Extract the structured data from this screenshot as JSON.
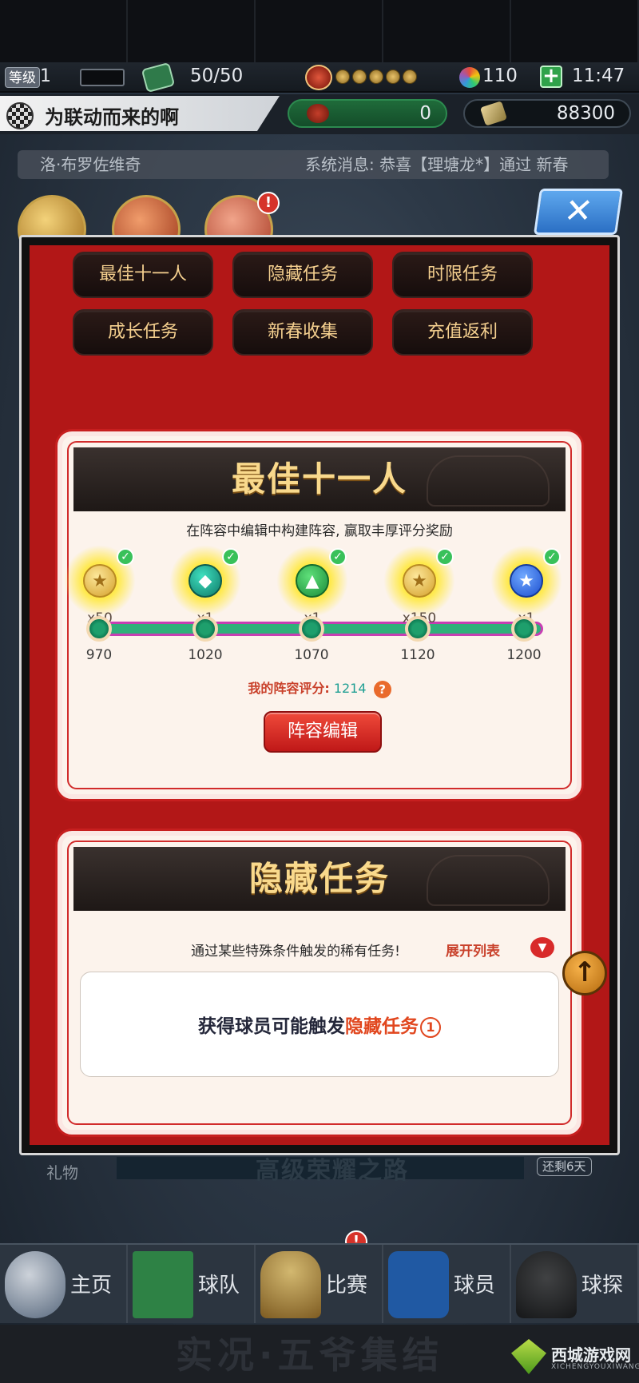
{
  "status": {
    "level_label": "等级",
    "level_value": "1",
    "stamina": "50/50",
    "gems": "110",
    "time": "11:47"
  },
  "profile": {
    "team_name": "为联动而来的啊",
    "red_currency": "0",
    "gold_currency": "88300"
  },
  "system_message": {
    "player": "洛·布罗佐维奇",
    "text": "系统消息: 恭喜【理塘龙*】通过 新春"
  },
  "tabs": [
    "最佳十一人",
    "隐藏任务",
    "时限任务",
    "成长任务",
    "新春收集",
    "充值返利"
  ],
  "best_eleven": {
    "title": "最佳十一人",
    "description": "在阵容中编辑中构建阵容, 赢取丰厚评分奖励",
    "rewards": [
      {
        "icon": "coin-icon",
        "glyph": "★",
        "qty": "x50",
        "threshold": "970",
        "claimed": true
      },
      {
        "icon": "ticket-icon",
        "glyph": "◆",
        "qty": "x1",
        "threshold": "1020",
        "claimed": true
      },
      {
        "icon": "boot-icon",
        "glyph": "▲",
        "qty": "x1",
        "threshold": "1070",
        "claimed": true
      },
      {
        "icon": "coin-icon",
        "glyph": "★",
        "qty": "x150",
        "threshold": "1120",
        "claimed": true
      },
      {
        "icon": "star-icon",
        "glyph": "★",
        "qty": "x1",
        "threshold": "1200",
        "claimed": true
      }
    ],
    "score_label": "我的阵容评分:",
    "score_value": "1214",
    "help_glyph": "?",
    "edit_button": "阵容编辑"
  },
  "hidden_tasks": {
    "title": "隐藏任务",
    "description": "通过某些特殊条件触发的稀有任务!",
    "expand_label": "展开列表",
    "box_prefix": "获得球员可能触发",
    "box_highlight": "隐藏任务",
    "box_count": "1"
  },
  "background": {
    "gift_label": "礼物",
    "banner_text": "高级荣耀之路",
    "days_left": "还剩6天",
    "footer_faded": "实况·五爷集结"
  },
  "bottom_nav": [
    "主页",
    "球队",
    "比赛",
    "球员",
    "球探"
  ],
  "watermark": {
    "name": "西城游戏网",
    "sub": "XICHENGYOUXIWANG"
  },
  "colors": {
    "modal_red": "#b21717",
    "title_gold": "#f9d98c",
    "track_green": "#2fb07a",
    "accent_orange": "#e1471f"
  }
}
